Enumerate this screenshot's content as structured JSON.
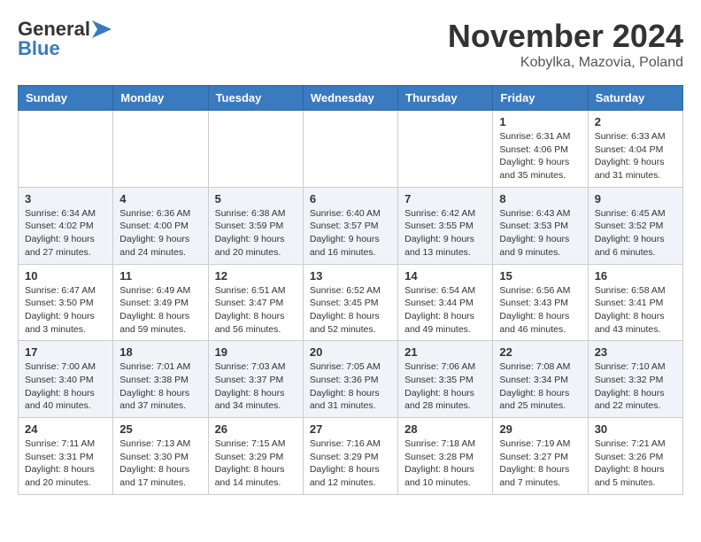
{
  "logo": {
    "line1": "General",
    "line2": "Blue"
  },
  "header": {
    "month": "November 2024",
    "location": "Kobylka, Mazovia, Poland"
  },
  "days_of_week": [
    "Sunday",
    "Monday",
    "Tuesday",
    "Wednesday",
    "Thursday",
    "Friday",
    "Saturday"
  ],
  "weeks": [
    [
      {
        "day": "",
        "info": ""
      },
      {
        "day": "",
        "info": ""
      },
      {
        "day": "",
        "info": ""
      },
      {
        "day": "",
        "info": ""
      },
      {
        "day": "",
        "info": ""
      },
      {
        "day": "1",
        "info": "Sunrise: 6:31 AM\nSunset: 4:06 PM\nDaylight: 9 hours and 35 minutes."
      },
      {
        "day": "2",
        "info": "Sunrise: 6:33 AM\nSunset: 4:04 PM\nDaylight: 9 hours and 31 minutes."
      }
    ],
    [
      {
        "day": "3",
        "info": "Sunrise: 6:34 AM\nSunset: 4:02 PM\nDaylight: 9 hours and 27 minutes."
      },
      {
        "day": "4",
        "info": "Sunrise: 6:36 AM\nSunset: 4:00 PM\nDaylight: 9 hours and 24 minutes."
      },
      {
        "day": "5",
        "info": "Sunrise: 6:38 AM\nSunset: 3:59 PM\nDaylight: 9 hours and 20 minutes."
      },
      {
        "day": "6",
        "info": "Sunrise: 6:40 AM\nSunset: 3:57 PM\nDaylight: 9 hours and 16 minutes."
      },
      {
        "day": "7",
        "info": "Sunrise: 6:42 AM\nSunset: 3:55 PM\nDaylight: 9 hours and 13 minutes."
      },
      {
        "day": "8",
        "info": "Sunrise: 6:43 AM\nSunset: 3:53 PM\nDaylight: 9 hours and 9 minutes."
      },
      {
        "day": "9",
        "info": "Sunrise: 6:45 AM\nSunset: 3:52 PM\nDaylight: 9 hours and 6 minutes."
      }
    ],
    [
      {
        "day": "10",
        "info": "Sunrise: 6:47 AM\nSunset: 3:50 PM\nDaylight: 9 hours and 3 minutes."
      },
      {
        "day": "11",
        "info": "Sunrise: 6:49 AM\nSunset: 3:49 PM\nDaylight: 8 hours and 59 minutes."
      },
      {
        "day": "12",
        "info": "Sunrise: 6:51 AM\nSunset: 3:47 PM\nDaylight: 8 hours and 56 minutes."
      },
      {
        "day": "13",
        "info": "Sunrise: 6:52 AM\nSunset: 3:45 PM\nDaylight: 8 hours and 52 minutes."
      },
      {
        "day": "14",
        "info": "Sunrise: 6:54 AM\nSunset: 3:44 PM\nDaylight: 8 hours and 49 minutes."
      },
      {
        "day": "15",
        "info": "Sunrise: 6:56 AM\nSunset: 3:43 PM\nDaylight: 8 hours and 46 minutes."
      },
      {
        "day": "16",
        "info": "Sunrise: 6:58 AM\nSunset: 3:41 PM\nDaylight: 8 hours and 43 minutes."
      }
    ],
    [
      {
        "day": "17",
        "info": "Sunrise: 7:00 AM\nSunset: 3:40 PM\nDaylight: 8 hours and 40 minutes."
      },
      {
        "day": "18",
        "info": "Sunrise: 7:01 AM\nSunset: 3:38 PM\nDaylight: 8 hours and 37 minutes."
      },
      {
        "day": "19",
        "info": "Sunrise: 7:03 AM\nSunset: 3:37 PM\nDaylight: 8 hours and 34 minutes."
      },
      {
        "day": "20",
        "info": "Sunrise: 7:05 AM\nSunset: 3:36 PM\nDaylight: 8 hours and 31 minutes."
      },
      {
        "day": "21",
        "info": "Sunrise: 7:06 AM\nSunset: 3:35 PM\nDaylight: 8 hours and 28 minutes."
      },
      {
        "day": "22",
        "info": "Sunrise: 7:08 AM\nSunset: 3:34 PM\nDaylight: 8 hours and 25 minutes."
      },
      {
        "day": "23",
        "info": "Sunrise: 7:10 AM\nSunset: 3:32 PM\nDaylight: 8 hours and 22 minutes."
      }
    ],
    [
      {
        "day": "24",
        "info": "Sunrise: 7:11 AM\nSunset: 3:31 PM\nDaylight: 8 hours and 20 minutes."
      },
      {
        "day": "25",
        "info": "Sunrise: 7:13 AM\nSunset: 3:30 PM\nDaylight: 8 hours and 17 minutes."
      },
      {
        "day": "26",
        "info": "Sunrise: 7:15 AM\nSunset: 3:29 PM\nDaylight: 8 hours and 14 minutes."
      },
      {
        "day": "27",
        "info": "Sunrise: 7:16 AM\nSunset: 3:29 PM\nDaylight: 8 hours and 12 minutes."
      },
      {
        "day": "28",
        "info": "Sunrise: 7:18 AM\nSunset: 3:28 PM\nDaylight: 8 hours and 10 minutes."
      },
      {
        "day": "29",
        "info": "Sunrise: 7:19 AM\nSunset: 3:27 PM\nDaylight: 8 hours and 7 minutes."
      },
      {
        "day": "30",
        "info": "Sunrise: 7:21 AM\nSunset: 3:26 PM\nDaylight: 8 hours and 5 minutes."
      }
    ]
  ]
}
